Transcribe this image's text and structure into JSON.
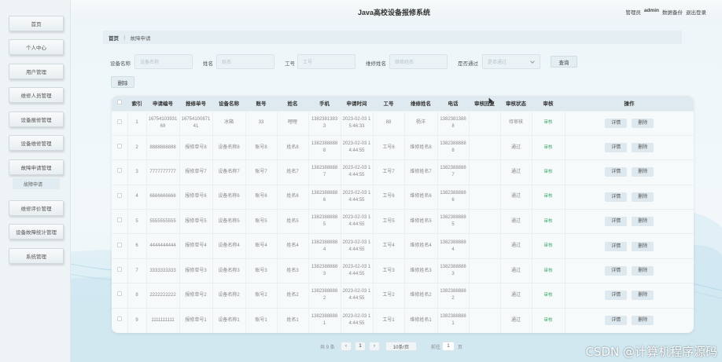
{
  "header": {
    "title": "Java高校设备报修系统",
    "role": "管理员",
    "username": "admin",
    "backup": "数据备份",
    "logout": "退出登录"
  },
  "sidebar": {
    "items": [
      {
        "label": "首页"
      },
      {
        "label": "个人中心"
      },
      {
        "label": "用户管理"
      },
      {
        "label": "维修人员管理"
      },
      {
        "label": "设备报修管理"
      },
      {
        "label": "设备维修管理"
      },
      {
        "label": "故障申请管理"
      },
      {
        "label": "维修评价管理"
      },
      {
        "label": "设备故障统计管理"
      },
      {
        "label": "系统管理"
      }
    ],
    "sub_item": "故障申请"
  },
  "breadcrumb": {
    "home": "首页",
    "separator": "⋮",
    "current": "故障申请"
  },
  "search": {
    "device_name_label": "设备名称",
    "device_name_placeholder": "设备名称",
    "name_label": "姓名",
    "name_placeholder": "姓名",
    "job_no_label": "工号",
    "job_no_placeholder": "工号",
    "repairer_label": "维修姓名",
    "repairer_placeholder": "维修姓名",
    "passed_label": "是否通过",
    "passed_placeholder": "是否通过",
    "query_button": "查询"
  },
  "delete_button": "删除",
  "table": {
    "headers": [
      "",
      "索引",
      "申请编号",
      "报修单号",
      "设备名称",
      "账号",
      "姓名",
      "手机",
      "申请时间",
      "工号",
      "维修姓名",
      "电话",
      "审核回复",
      "审核状态",
      "审核",
      "操作"
    ],
    "rows": [
      {
        "idx": "1",
        "apply_no": "1675410393169",
        "order_no": "1675410087141",
        "device": "冰箱",
        "account": "33",
        "name": "哩哩",
        "phone": "13823813833",
        "time": "2023-02-03 15:46:33",
        "job_no": "88",
        "repairer": "杨洋",
        "tel": "13823813888",
        "reply": "",
        "status": "待审核",
        "audit": "审核",
        "detail": "详情",
        "del": "删除"
      },
      {
        "idx": "2",
        "apply_no": "8888888888",
        "order_no": "报修单号8",
        "device": "设备名称8",
        "account": "账号8",
        "name": "姓名8",
        "phone": "13823888888",
        "time": "2023-02-03 14:44:55",
        "job_no": "工号8",
        "repairer": "维修姓名8",
        "tel": "13823888888",
        "reply": "",
        "status": "通过",
        "audit": "审核",
        "detail": "详情",
        "del": "删除"
      },
      {
        "idx": "3",
        "apply_no": "7777777777",
        "order_no": "报修单号7",
        "device": "设备名称7",
        "account": "账号7",
        "name": "姓名7",
        "phone": "13823888887",
        "time": "2023-02-03 14:44:55",
        "job_no": "工号7",
        "repairer": "维修姓名7",
        "tel": "13823888887",
        "reply": "",
        "status": "通过",
        "audit": "审核",
        "detail": "详情",
        "del": "删除"
      },
      {
        "idx": "4",
        "apply_no": "6666666666",
        "order_no": "报修单号6",
        "device": "设备名称6",
        "account": "账号6",
        "name": "姓名6",
        "phone": "13823888886",
        "time": "2023-02-03 14:44:55",
        "job_no": "工号6",
        "repairer": "维修姓名6",
        "tel": "13823888886",
        "reply": "",
        "status": "通过",
        "audit": "审核",
        "detail": "详情",
        "del": "删除"
      },
      {
        "idx": "5",
        "apply_no": "5555555555",
        "order_no": "报修单号5",
        "device": "设备名称5",
        "account": "账号5",
        "name": "姓名5",
        "phone": "13823888885",
        "time": "2023-02-03 14:44:55",
        "job_no": "工号5",
        "repairer": "维修姓名5",
        "tel": "13823888885",
        "reply": "",
        "status": "通过",
        "audit": "审核",
        "detail": "详情",
        "del": "删除"
      },
      {
        "idx": "6",
        "apply_no": "4444444444",
        "order_no": "报修单号4",
        "device": "设备名称4",
        "account": "账号4",
        "name": "姓名4",
        "phone": "13823888884",
        "time": "2023-02-03 14:44:55",
        "job_no": "工号4",
        "repairer": "维修姓名4",
        "tel": "13823888884",
        "reply": "",
        "status": "通过",
        "audit": "审核",
        "detail": "详情",
        "del": "删除"
      },
      {
        "idx": "7",
        "apply_no": "3333333333",
        "order_no": "报修单号3",
        "device": "设备名称3",
        "account": "账号3",
        "name": "姓名3",
        "phone": "13823888883",
        "time": "2023-02-03 14:44:55",
        "job_no": "工号3",
        "repairer": "维修姓名3",
        "tel": "13823888883",
        "reply": "",
        "status": "通过",
        "audit": "审核",
        "detail": "详情",
        "del": "删除"
      },
      {
        "idx": "8",
        "apply_no": "2222222222",
        "order_no": "报修单号2",
        "device": "设备名称2",
        "account": "账号2",
        "name": "姓名2",
        "phone": "13823888882",
        "time": "2023-02-03 14:44:55",
        "job_no": "工号2",
        "repairer": "维修姓名2",
        "tel": "13823888882",
        "reply": "",
        "status": "通过",
        "audit": "审核",
        "detail": "详情",
        "del": "删除"
      },
      {
        "idx": "9",
        "apply_no": "1111111111",
        "order_no": "报修单号1",
        "device": "设备名称1",
        "account": "账号1",
        "name": "姓名1",
        "phone": "13823888881",
        "time": "2023-02-03 14:44:55",
        "job_no": "工号1",
        "repairer": "维修姓名1",
        "tel": "13823888881",
        "reply": "",
        "status": "通过",
        "audit": "审核",
        "detail": "详情",
        "del": "删除"
      }
    ]
  },
  "pagination": {
    "total": "共 9 条",
    "prev": "‹",
    "page": "1",
    "next": "›",
    "page_size": "10条/页",
    "goto_label": "前往",
    "goto_value": "1",
    "page_unit": "页"
  },
  "watermark": "CSDN @计算机程序源码"
}
